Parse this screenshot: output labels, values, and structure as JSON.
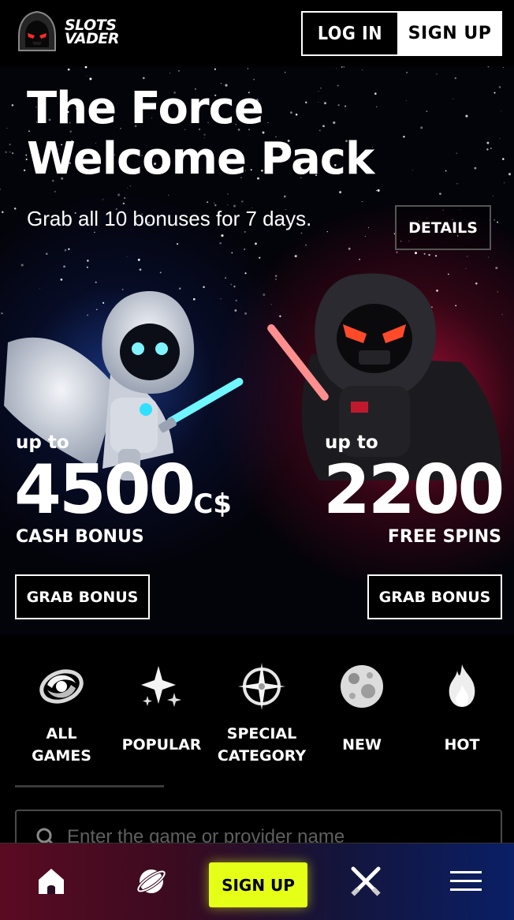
{
  "header": {
    "logo_line1": "SLOTS",
    "logo_line2": "VADER",
    "login_label": "LOG IN",
    "signup_label": "SIGN UP"
  },
  "hero": {
    "title": "The Force Welcome Pack",
    "subtitle": "Grab all 10 bonuses for 7 days.",
    "details_label": "DETAILS",
    "offers": [
      {
        "prefix": "up to",
        "amount": "4500",
        "currency": "C$",
        "label": "CASH BONUS",
        "button": "GRAB BONUS"
      },
      {
        "prefix": "up to",
        "amount": "2200",
        "currency": "",
        "label": "FREE SPINS",
        "button": "GRAB BONUS"
      }
    ]
  },
  "categories": [
    {
      "line1": "ALL",
      "line2": "GAMES",
      "icon": "galaxy-icon"
    },
    {
      "line1": "POPULAR",
      "line2": "",
      "icon": "sparkles-icon"
    },
    {
      "line1": "SPECIAL",
      "line2": "CATEGORY",
      "icon": "compass-star-icon"
    },
    {
      "line1": "NEW",
      "line2": "",
      "icon": "moon-icon"
    },
    {
      "line1": "HOT",
      "line2": "",
      "icon": "flame-icon"
    }
  ],
  "search": {
    "placeholder": "Enter the game or provider name"
  },
  "bottom_nav": {
    "signup_label": "SIGN UP",
    "icons": [
      "home-icon",
      "planet-icon",
      "crossed-sabers-icon",
      "menu-icon"
    ]
  },
  "colors": {
    "accent_yellow": "#e6ff17",
    "glow_blue": "#2f6fff",
    "glow_red": "#e0144a"
  }
}
